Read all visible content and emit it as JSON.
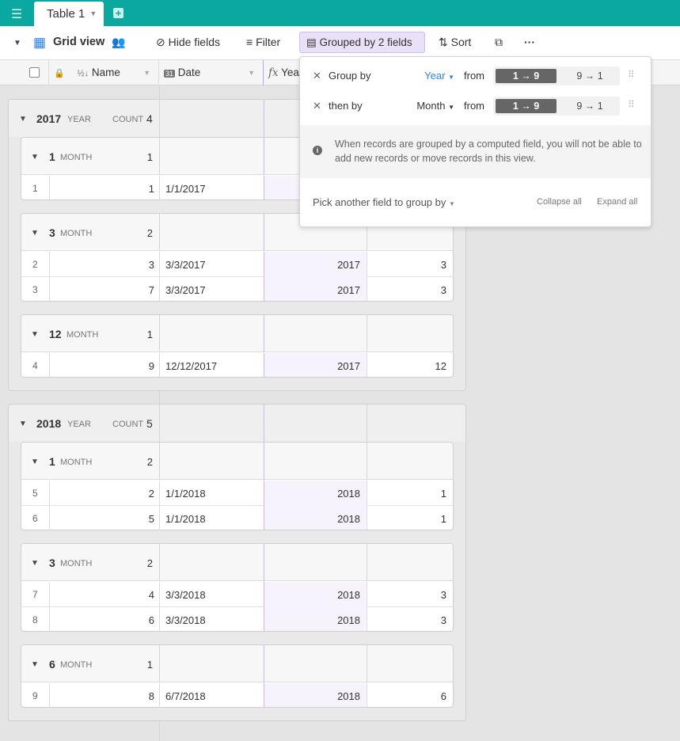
{
  "app": {
    "table_tab": "Table 1"
  },
  "toolbar": {
    "view_name": "Grid view",
    "hide_fields": "Hide fields",
    "filter": "Filter",
    "grouped": "Grouped by 2 fields",
    "sort": "Sort"
  },
  "columns": [
    "Name",
    "Date",
    "Year"
  ],
  "labels": {
    "year": "YEAR",
    "month": "MONTH",
    "count": "COUNT"
  },
  "groups": [
    {
      "year": "2017",
      "count": "4",
      "subgroups": [
        {
          "month": "1",
          "count": "1",
          "rows": [
            [
              "1",
              "1",
              "1/1/2017",
              "",
              ""
            ]
          ]
        },
        {
          "month": "3",
          "count": "2",
          "rows": [
            [
              "2",
              "3",
              "3/3/2017",
              "2017",
              "3"
            ],
            [
              "3",
              "7",
              "3/3/2017",
              "2017",
              "3"
            ]
          ]
        },
        {
          "month": "12",
          "count": "1",
          "rows": [
            [
              "4",
              "9",
              "12/12/2017",
              "2017",
              "12"
            ]
          ]
        }
      ]
    },
    {
      "year": "2018",
      "count": "5",
      "subgroups": [
        {
          "month": "1",
          "count": "2",
          "rows": [
            [
              "5",
              "2",
              "1/1/2018",
              "2018",
              "1"
            ],
            [
              "6",
              "5",
              "1/1/2018",
              "2018",
              "1"
            ]
          ]
        },
        {
          "month": "3",
          "count": "2",
          "rows": [
            [
              "7",
              "4",
              "3/3/2018",
              "2018",
              "3"
            ],
            [
              "8",
              "6",
              "3/3/2018",
              "2018",
              "3"
            ]
          ]
        },
        {
          "month": "6",
          "count": "1",
          "rows": [
            [
              "9",
              "8",
              "6/7/2018",
              "2018",
              "6"
            ]
          ]
        }
      ]
    }
  ],
  "popover": {
    "rules": [
      {
        "prefix": "Group by",
        "field": "Year",
        "from": "from",
        "asc": "1 → 9",
        "desc": "9 → 1",
        "field_color": "#2d7ff9"
      },
      {
        "prefix": "then by",
        "field": "Month",
        "from": "from",
        "asc": "1 → 9",
        "desc": "9 → 1",
        "field_color": "#333333"
      }
    ],
    "info": "When records are grouped by a computed field, you will not be able to add new records or move records in this view.",
    "pick": "Pick another field to group by",
    "collapse": "Collapse all",
    "expand": "Expand all"
  },
  "colors": {
    "brand": "#0aa89e",
    "formula_tint": "#f6f3fd",
    "group_accent": "#e9e1f7"
  }
}
